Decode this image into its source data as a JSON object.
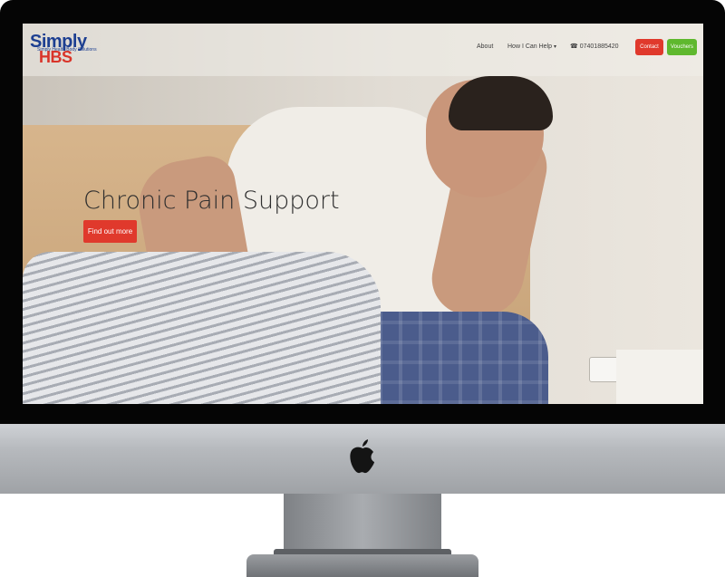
{
  "site": {
    "logo": {
      "main": "Simply",
      "sub": "HBS",
      "tagline": "Simply Health Body Solutions"
    },
    "nav": {
      "about": "About",
      "how_i_can_help": "How I Can Help",
      "dropdown_icon": "caret-down-icon",
      "phone_icon": "phone-icon",
      "phone": "07401885420",
      "contact": "Contact",
      "vouchers": "Vouchers"
    },
    "hero": {
      "title": "Chronic Pain Support",
      "cta": "Find out more"
    }
  },
  "colors": {
    "brand_blue": "#1d3f91",
    "brand_red": "#e0392c",
    "vouchers_green": "#5fb82e"
  },
  "device": {
    "brand_icon": "apple-logo-icon"
  }
}
